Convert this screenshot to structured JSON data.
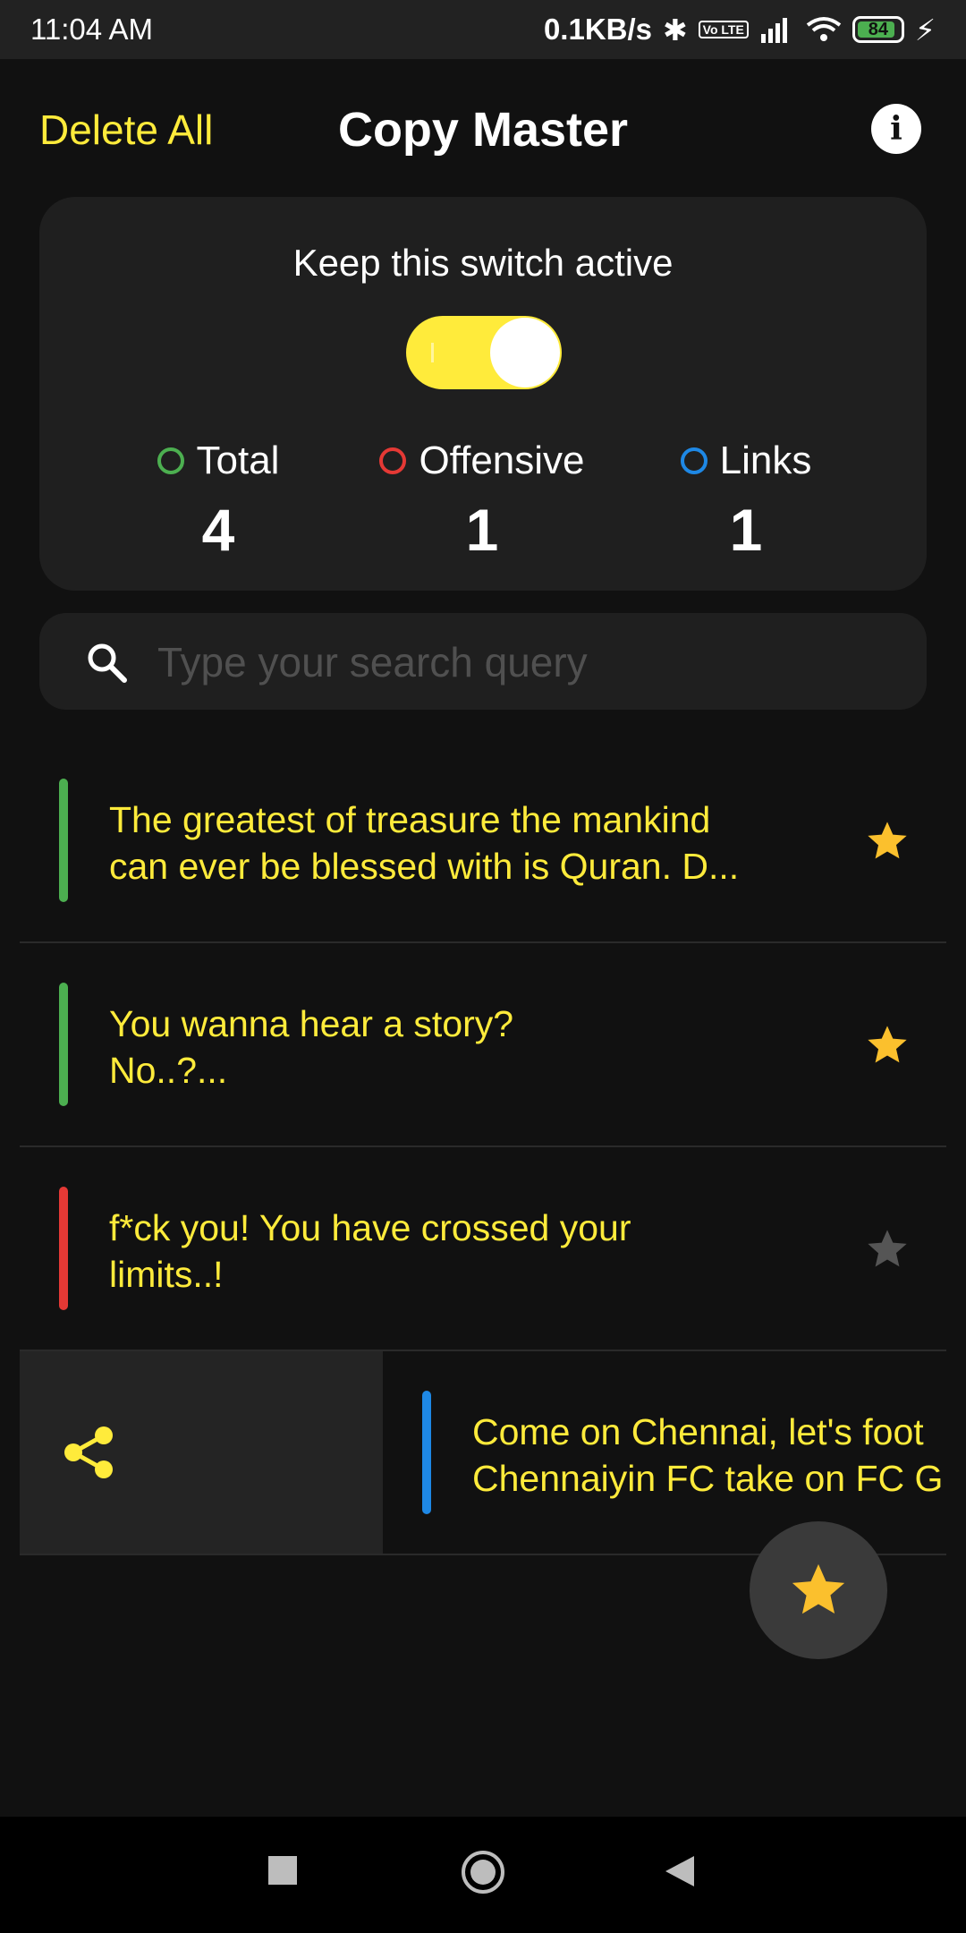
{
  "status_bar": {
    "time": "11:04 AM",
    "speed": "0.1KB/s",
    "lte": "Vo LTE",
    "battery": "84"
  },
  "header": {
    "delete_all": "Delete All",
    "title": "Copy Master",
    "info_icon": "info-icon"
  },
  "monitor_card": {
    "hint": "Keep this switch active",
    "switch_on": true,
    "stats": [
      {
        "label": "Total",
        "value": "4",
        "color": "#4caf50"
      },
      {
        "label": "Offensive",
        "value": "1",
        "color": "#e53935"
      },
      {
        "label": "Links",
        "value": "1",
        "color": "#1e88e5"
      }
    ]
  },
  "search": {
    "placeholder": "Type your search query",
    "value": ""
  },
  "clips": [
    {
      "text": "The greatest of treasure the mankind\ncan ever be blessed with is Quran. D...",
      "category_color": "#4caf50",
      "starred": true
    },
    {
      "text": "You wanna hear a story?\nNo..?...",
      "category_color": "#4caf50",
      "starred": true
    },
    {
      "text": "f*ck you! You have crossed your\nlimits..!",
      "category_color": "#e53935",
      "starred": false
    },
    {
      "text": "Come on Chennai, let's foot\nChennaiyin FC take on FC G",
      "category_color": "#1e88e5",
      "starred": false,
      "swiped": true
    }
  ],
  "colors": {
    "accent": "#ffeb3b",
    "star_active": "#fbc02d",
    "star_inactive": "#555555"
  },
  "fab": {
    "icon": "star-icon"
  },
  "nav": {
    "icons": [
      "recents-square-icon",
      "home-circle-icon",
      "back-triangle-icon"
    ]
  }
}
